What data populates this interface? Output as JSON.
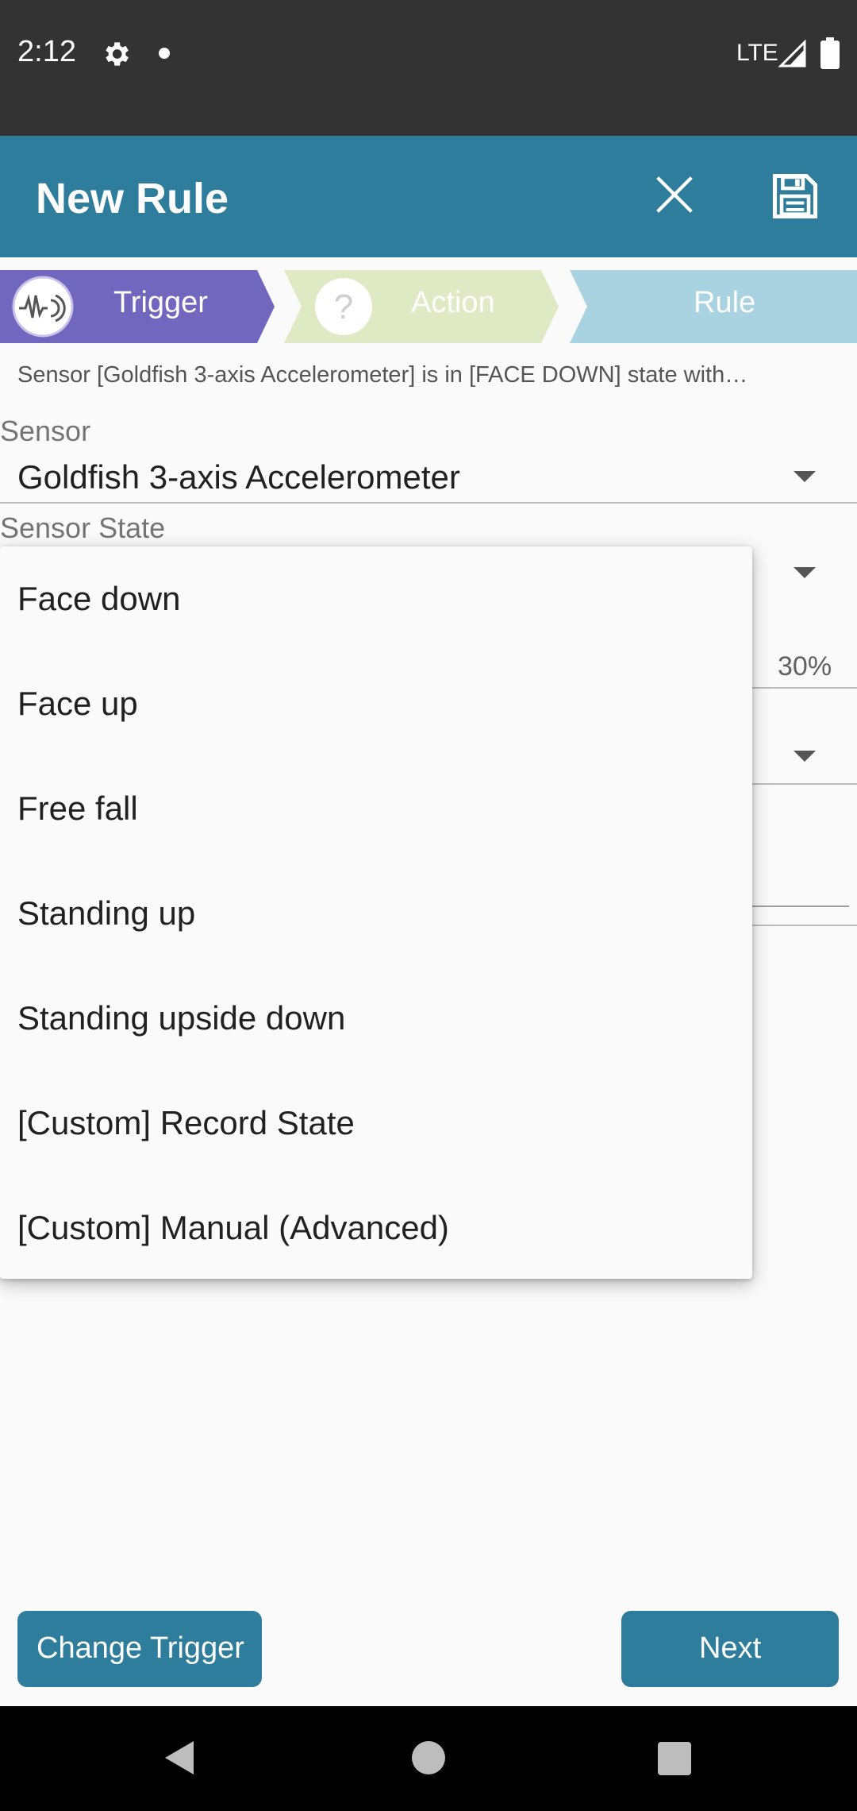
{
  "status_bar": {
    "time": "2:12",
    "network": "LTE",
    "icons": [
      "gear-icon",
      "dot-icon",
      "signal-icon",
      "battery-icon"
    ]
  },
  "toolbar": {
    "title": "New Rule",
    "close_icon": "close-icon",
    "save_icon": "floppy-disk-icon"
  },
  "steps": [
    {
      "label": "Trigger",
      "icon": "waveform-sensor-icon",
      "state": "active",
      "color": "#7267be"
    },
    {
      "label": "Action",
      "icon": "question-icon",
      "state": "inactive",
      "color": "#dfeac4"
    },
    {
      "label": "Rule",
      "state": "inactive",
      "color": "#a9d3e1"
    }
  ],
  "summary": "Sensor [Goldfish 3-axis Accelerometer] is in [FACE DOWN] state with…",
  "fields": {
    "sensor_label": "Sensor",
    "sensor_value": "Goldfish 3-axis Accelerometer",
    "state_label": "Sensor State",
    "sensitivity_value": "30%"
  },
  "dropdown": {
    "items": [
      "Face down",
      "Face up",
      "Free fall",
      "Standing up",
      "Standing upside down",
      "[Custom] Record State",
      "[Custom] Manual (Advanced)"
    ]
  },
  "buttons": {
    "change_trigger": "Change Trigger",
    "next": "Next"
  },
  "colors": {
    "primary": "#2f7d9c",
    "status_bar": "#333333",
    "trigger_step": "#7267be",
    "action_step": "#dfeac4",
    "rule_step": "#a9d3e1"
  }
}
